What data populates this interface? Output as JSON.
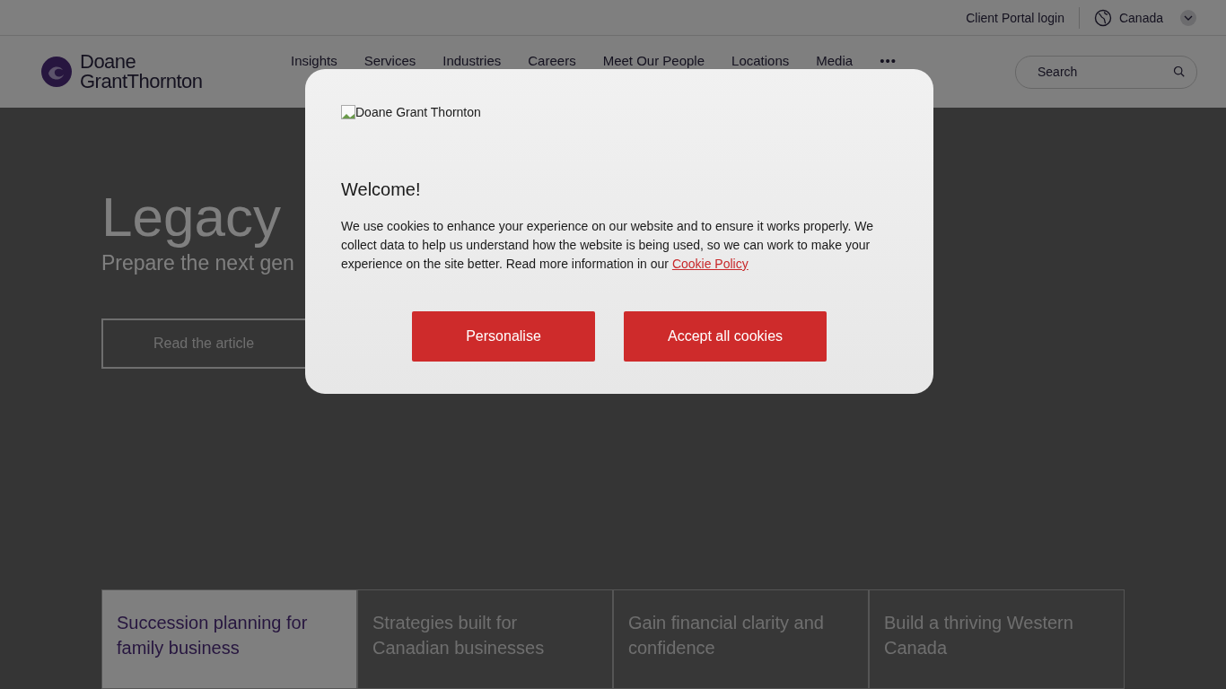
{
  "top_bar": {
    "client_portal": "Client Portal login",
    "region": "Canada"
  },
  "header": {
    "logo_line_1": "Doane",
    "logo_line_2": "GrantThornton",
    "nav": [
      "Insights",
      "Services",
      "Industries",
      "Careers",
      "Meet Our People",
      "Locations",
      "Media"
    ],
    "more": "•••",
    "search": {
      "placeholder": "Search"
    }
  },
  "hero": {
    "title": "Legacy",
    "subtitle": "Prepare the next gen",
    "button": "Read the article"
  },
  "cards": [
    {
      "title": "Succession planning for family business",
      "selected": true
    },
    {
      "title": "Strategies built for Canadian businesses",
      "selected": false
    },
    {
      "title": "Gain financial clarity and confidence",
      "selected": false
    },
    {
      "title": "Build a thriving Western Canada",
      "selected": false
    }
  ],
  "cookie_dialog": {
    "image_alt": "Doane Grant Thornton",
    "heading": "Welcome!",
    "body": "We use cookies to enhance your experience on our website and to ensure it works properly. We collect data to help us understand how the website is being used, so we can work to make your experience on the site better. Read more information in our",
    "link": "Cookie Policy",
    "buttons": [
      "Personalise",
      "Accept all cookies"
    ]
  }
}
